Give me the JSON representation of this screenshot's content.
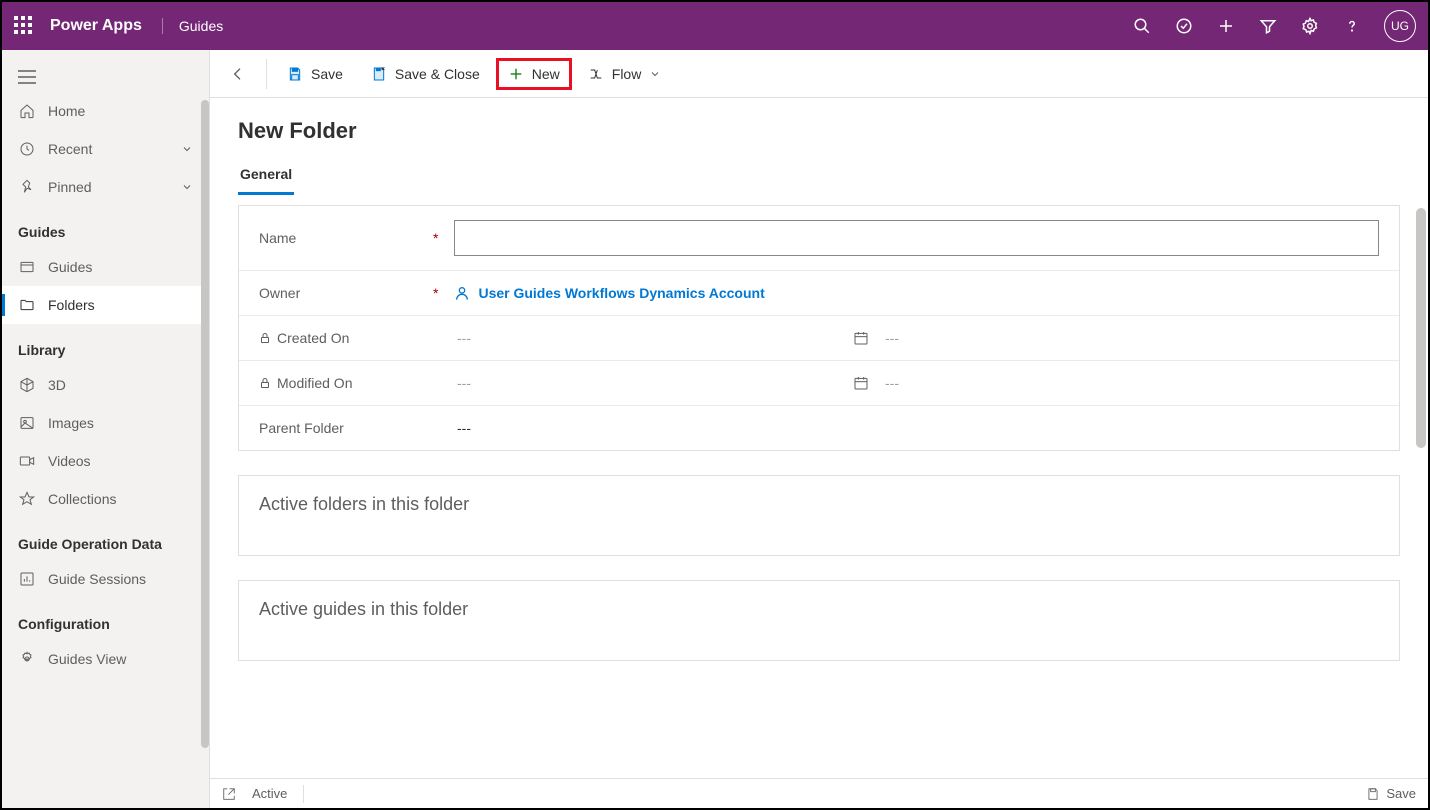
{
  "topbar": {
    "appName": "Power Apps",
    "subApp": "Guides",
    "avatar": "UG"
  },
  "sidebar": {
    "nav": {
      "home": "Home",
      "recent": "Recent",
      "pinned": "Pinned"
    },
    "sections": {
      "guides": {
        "header": "Guides",
        "guides": "Guides",
        "folders": "Folders"
      },
      "library": {
        "header": "Library",
        "threeD": "3D",
        "images": "Images",
        "videos": "Videos",
        "collections": "Collections"
      },
      "guideOp": {
        "header": "Guide Operation Data",
        "sessions": "Guide Sessions"
      },
      "config": {
        "header": "Configuration",
        "guidesView": "Guides View"
      }
    }
  },
  "cmdbar": {
    "save": "Save",
    "saveClose": "Save & Close",
    "new": "New",
    "flow": "Flow"
  },
  "page": {
    "title": "New Folder",
    "tab": "General",
    "fields": {
      "nameLabel": "Name",
      "nameValue": "",
      "ownerLabel": "Owner",
      "ownerValue": "User Guides Workflows Dynamics Account",
      "createdOnLabel": "Created On",
      "createdOnDate": "---",
      "createdOnTime": "---",
      "modifiedOnLabel": "Modified On",
      "modifiedOnDate": "---",
      "modifiedOnTime": "---",
      "parentFolderLabel": "Parent Folder",
      "parentFolderValue": "---"
    },
    "sections": {
      "activeFolders": "Active folders in this folder",
      "activeGuides": "Active guides in this folder"
    }
  },
  "statusbar": {
    "status": "Active",
    "save": "Save"
  }
}
